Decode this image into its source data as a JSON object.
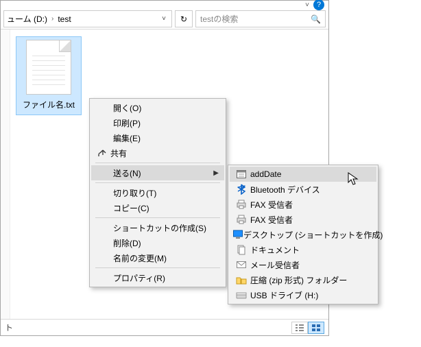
{
  "title_dropdown_glyph": "˅",
  "help_glyph": "?",
  "breadcrumb": {
    "part1": "ューム (D:)",
    "sep": "›",
    "part2": "test",
    "dropdown": "˅"
  },
  "refresh_glyph": "↻",
  "search": {
    "placeholder": "testの検索",
    "icon": "🔍"
  },
  "file": {
    "name": "ファイル名.txt"
  },
  "statusbar": {
    "text": "ト"
  },
  "context_menu": {
    "open": "開く(O)",
    "print": "印刷(P)",
    "edit": "編集(E)",
    "share": "共有",
    "sendto": "送る(N)",
    "cut": "切り取り(T)",
    "copy": "コピー(C)",
    "shortcut": "ショートカットの作成(S)",
    "delete": "削除(D)",
    "rename": "名前の変更(M)",
    "properties": "プロパティ(R)"
  },
  "sendto_menu": {
    "addDate": "addDate",
    "bluetooth": "Bluetooth デバイス",
    "fax1": "FAX 受信者",
    "fax2": "FAX 受信者",
    "desktop": "デスクトップ (ショートカットを作成)",
    "documents": "ドキュメント",
    "mail": "メール受信者",
    "zip": "圧縮 (zip 形式) フォルダー",
    "usb": "USB ドライブ (H:)"
  }
}
